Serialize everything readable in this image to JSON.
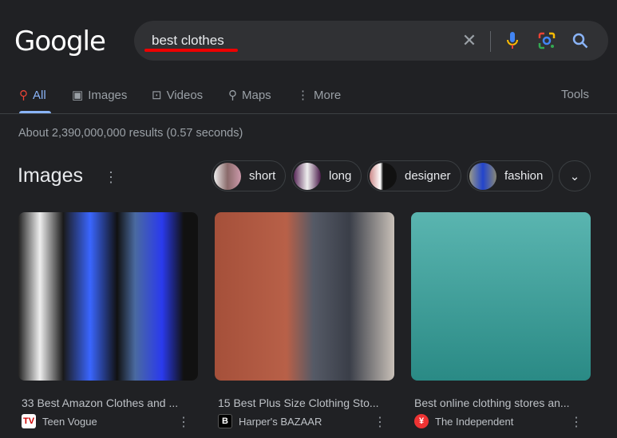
{
  "logo": "Google",
  "search": {
    "query": "best clothes"
  },
  "tabs": [
    {
      "label": "All",
      "icon": "search-icon"
    },
    {
      "label": "Images",
      "icon": "image-icon"
    },
    {
      "label": "Videos",
      "icon": "play-icon"
    },
    {
      "label": "Maps",
      "icon": "pin-icon"
    },
    {
      "label": "More",
      "icon": "more-vert-icon"
    }
  ],
  "tools": "Tools",
  "stats": "About 2,390,000,000 results (0.57 seconds)",
  "images": {
    "title": "Images",
    "chips": [
      "short",
      "long",
      "designer",
      "fashion"
    ]
  },
  "results": [
    {
      "title": "33 Best Amazon Clothes and ...",
      "source": "Teen Vogue",
      "fav": "TV"
    },
    {
      "title": "15 Best Plus Size Clothing Sto...",
      "source": "Harper's BAZAAR",
      "fav": "B"
    },
    {
      "title": "Best online clothing stores an...",
      "source": "The Independent",
      "fav": "¥"
    }
  ],
  "colors": {
    "background": "#202124",
    "accent": "#8ab4f8",
    "underline": "#ee0000"
  }
}
